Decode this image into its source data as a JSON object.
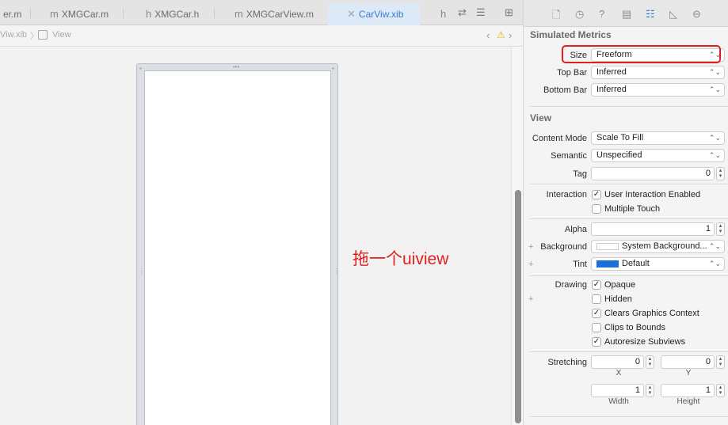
{
  "tabs": [
    {
      "prefix": "",
      "label": "er.m"
    },
    {
      "prefix": "m",
      "label": "XMGCar.m"
    },
    {
      "prefix": "h",
      "label": "XMGCar.h"
    },
    {
      "prefix": "m",
      "label": "XMGCarView.m"
    },
    {
      "prefix": "✕",
      "label": "CarViw.xib"
    },
    {
      "prefix": "h",
      "label": ""
    }
  ],
  "jumpbar": {
    "file": "Viw.xib",
    "item": "View"
  },
  "annotation": "拖一个uiview",
  "inspector": {
    "simulated_metrics": {
      "title": "Simulated Metrics",
      "size_label": "Size",
      "size_value": "Freeform",
      "topbar_label": "Top Bar",
      "topbar_value": "Inferred",
      "bottombar_label": "Bottom Bar",
      "bottombar_value": "Inferred"
    },
    "view": {
      "title": "View",
      "content_mode_label": "Content Mode",
      "content_mode_value": "Scale To Fill",
      "semantic_label": "Semantic",
      "semantic_value": "Unspecified",
      "tag_label": "Tag",
      "tag_value": "0",
      "interaction_label": "Interaction",
      "user_interaction": "User Interaction Enabled",
      "multiple_touch": "Multiple Touch",
      "alpha_label": "Alpha",
      "alpha_value": "1",
      "background_label": "Background",
      "background_value": "System Background...",
      "tint_label": "Tint",
      "tint_value": "Default",
      "drawing_label": "Drawing",
      "opaque": "Opaque",
      "hidden": "Hidden",
      "clears_graphics": "Clears Graphics Context",
      "clips_to_bounds": "Clips to Bounds",
      "autoresize": "Autoresize Subviews",
      "stretching_label": "Stretching",
      "stretch_x": "0",
      "stretch_y": "0",
      "stretch_w": "1",
      "stretch_h": "1",
      "x_label": "X",
      "y_label": "Y",
      "width_label": "Width",
      "height_label": "Height"
    }
  },
  "icons": {
    "tint_color": "#1a6fd8",
    "background_color": "#ffffff",
    "accent": "#3b7ad4",
    "annotation_color": "#e02020"
  }
}
